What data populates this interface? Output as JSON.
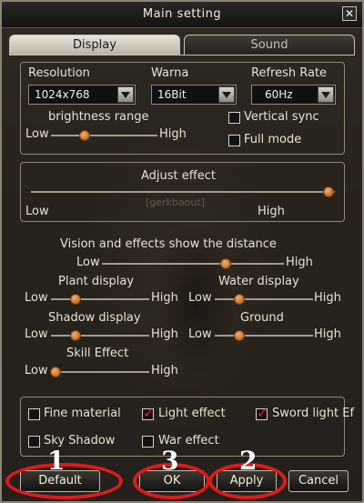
{
  "window": {
    "title": "Main setting"
  },
  "tabs": [
    {
      "label": "Display",
      "active": true
    },
    {
      "label": "Sound",
      "active": false
    }
  ],
  "display": {
    "resolution_label": "Resolution",
    "resolution_value": "1024x768",
    "warna_label": "Warna",
    "warna_value": "16Bit",
    "refresh_label": "Refresh Rate",
    "refresh_value": "60Hz",
    "brightness_label": "brightness range",
    "brightness_low": "Low",
    "brightness_high": "High",
    "brightness_level": 0.32,
    "vertical_sync_label": "Vertical sync",
    "vertical_sync_checked": false,
    "full_mode_label": "Full mode",
    "full_mode_checked": false
  },
  "adjust_effect": {
    "label": "Adjust effect",
    "low": "Low",
    "high": "High",
    "level": 0.98
  },
  "watermark": "[gerkbaout]",
  "distance": {
    "heading": "Vision and effects show the distance",
    "main": {
      "low": "Low",
      "high": "High",
      "level": 0.68
    },
    "plant": {
      "label": "Plant display",
      "low": "Low",
      "high": "High",
      "level": 0.25
    },
    "water": {
      "label": "Water display",
      "low": "Low",
      "high": "High",
      "level": 0.25
    },
    "shadow": {
      "label": "Shadow display",
      "low": "Low",
      "high": "High",
      "level": 0.25
    },
    "ground": {
      "label": "Ground",
      "low": "Low",
      "high": "High",
      "level": 0.25
    },
    "skill": {
      "label": "Skill Effect",
      "low": "Low",
      "high": "High",
      "level": 0.05
    }
  },
  "effects": [
    {
      "label": "Fine material",
      "checked": false
    },
    {
      "label": "Light effect",
      "checked": true
    },
    {
      "label": "Sword light Ef",
      "checked": true
    },
    {
      "label": "Sky Shadow",
      "checked": false
    },
    {
      "label": "War effect",
      "checked": false
    }
  ],
  "buttons": {
    "default": "Default",
    "ok": "OK",
    "apply": "Apply",
    "cancel": "Cancel"
  },
  "annotations": {
    "one": "1",
    "two": "2",
    "three": "3",
    "ring_color": "#e0191b"
  }
}
